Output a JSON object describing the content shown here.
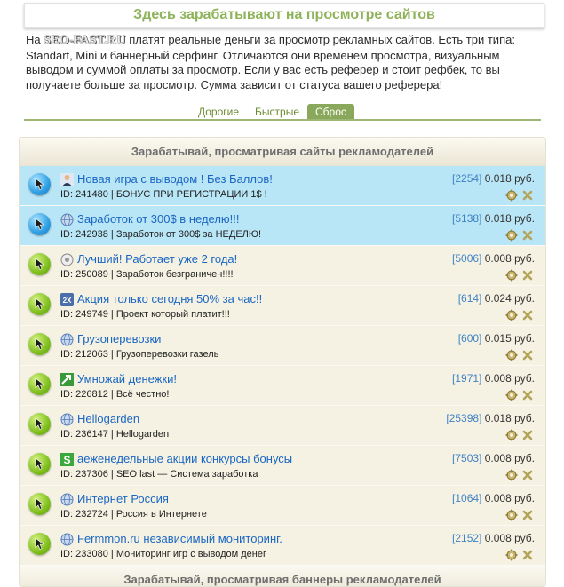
{
  "page_title": "Здесь зарабатывают на просмотре сайтов",
  "intro": {
    "prefix": "На",
    "logo_main": "SEO-FAST",
    "logo_tld": ".RU",
    "text": "платят реальные деньги за просмотр рекламных сайтов. Есть три типа: Standart, Mini и баннерный сёрфинг. Отличаются они временем просмотра, визуальным выводом и суммой оплаты за просмотр. Если у вас есть реферер и стоит рефбек, то вы получаете больше за просмотр. Сумма зависит от статуса вашего реферера!"
  },
  "tabs": [
    {
      "label": "Дорогие",
      "active": false
    },
    {
      "label": "Быстрые",
      "active": false
    },
    {
      "label": "Сброс",
      "active": true
    }
  ],
  "section_title": "Зарабатывай, просматривая сайты рекламодателей",
  "footer_title": "Зарабатывай, просматривая баннеры рекламодателей",
  "colors": {
    "accent_green": "#8fb35a",
    "link_blue": "#1a66c2",
    "highlight_row": "#b9e6f6",
    "panel_bg": "#f5f2e3"
  },
  "rows": [
    {
      "icon": "user-avatar-icon",
      "title": "Новая игра с выводом ! Без Баллов!",
      "id_label": "ID: 241480",
      "desc": "БОНУС ПРИ РЕГИСТРАЦИИ 1$ !",
      "count": "[2254]",
      "price": "0.018 руб.",
      "highlight": true
    },
    {
      "icon": "globe-icon",
      "title": "Заработок от 300$ в неделю!!!",
      "id_label": "ID: 242938",
      "desc": "Заработок от 300$ за НЕДЕЛЮ!",
      "count": "[5138]",
      "price": "0.018 руб.",
      "highlight": true
    },
    {
      "icon": "gear-badge-icon",
      "title": "Лучший! Работает уже 2 года!",
      "id_label": "ID: 250089",
      "desc": "Заработок безграничен!!!!",
      "count": "[5006]",
      "price": "0.008 руб.",
      "highlight": false
    },
    {
      "icon": "2x-badge-icon",
      "title": "Акция только сегодня 50% за час!!",
      "id_label": "ID: 249749",
      "desc": "Проект который платит!!!",
      "count": "[614]",
      "price": "0.024 руб.",
      "highlight": false
    },
    {
      "icon": "globe-icon",
      "title": "Грузоперевозки",
      "id_label": "ID: 212063",
      "desc": "Грузоперевозки газель",
      "count": "[600]",
      "price": "0.015 руб.",
      "highlight": false
    },
    {
      "icon": "growth-arrow-icon",
      "title": "Умножай денежки!",
      "id_label": "ID: 226812",
      "desc": "Всё честно!",
      "count": "[1971]",
      "price": "0.008 руб.",
      "highlight": false
    },
    {
      "icon": "globe-icon",
      "title": "Hellogarden",
      "id_label": "ID: 236147",
      "desc": "Hellogarden",
      "count": "[25398]",
      "price": "0.018 руб.",
      "highlight": false
    },
    {
      "icon": "s-logo-icon",
      "title": "аеженедельные акции конкурсы бонусы",
      "id_label": "ID: 237306",
      "desc": "SEO last — Система заработка",
      "count": "[7503]",
      "price": "0.008 руб.",
      "highlight": false
    },
    {
      "icon": "globe-icon",
      "title": "Интернет Россия",
      "id_label": "ID: 232724",
      "desc": "Россия в Интернете",
      "count": "[1064]",
      "price": "0.008 руб.",
      "highlight": false
    },
    {
      "icon": "globe-icon",
      "title": "Fermmon.ru независимый мониторинг.",
      "id_label": "ID: 233080",
      "desc": "Мониторинг игр с выводом денег",
      "count": "[2152]",
      "price": "0.008 руб.",
      "highlight": false
    }
  ]
}
